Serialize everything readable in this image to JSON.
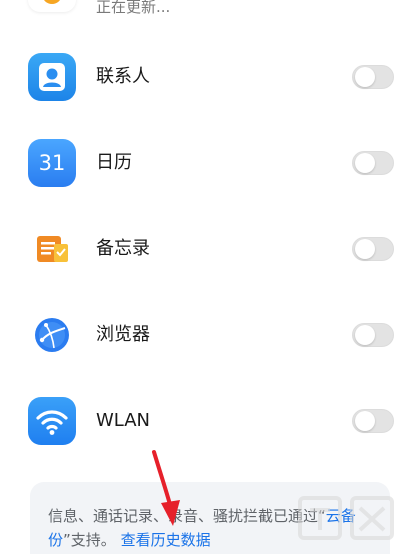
{
  "top_row": {
    "status_text": "正在更新..."
  },
  "rows": [
    {
      "label": "联系人",
      "icon": "contacts-icon",
      "enabled": false
    },
    {
      "label": "日历",
      "icon": "calendar-icon",
      "icon_text": "31",
      "enabled": false
    },
    {
      "label": "备忘录",
      "icon": "notes-icon",
      "enabled": false
    },
    {
      "label": "浏览器",
      "icon": "browser-icon",
      "enabled": false
    },
    {
      "label": "WLAN",
      "icon": "wifi-icon",
      "enabled": false
    }
  ],
  "info": {
    "text_prefix": "信息、通话记录、录音、骚扰拦截已通过“",
    "text_link_inline": "云备份",
    "text_suffix": "”支持。",
    "link": "查看历史数据"
  },
  "colors": {
    "accent": "#1a73e8",
    "toggle_off": "#e3e3e3",
    "annotation_arrow": "#e6202a"
  }
}
